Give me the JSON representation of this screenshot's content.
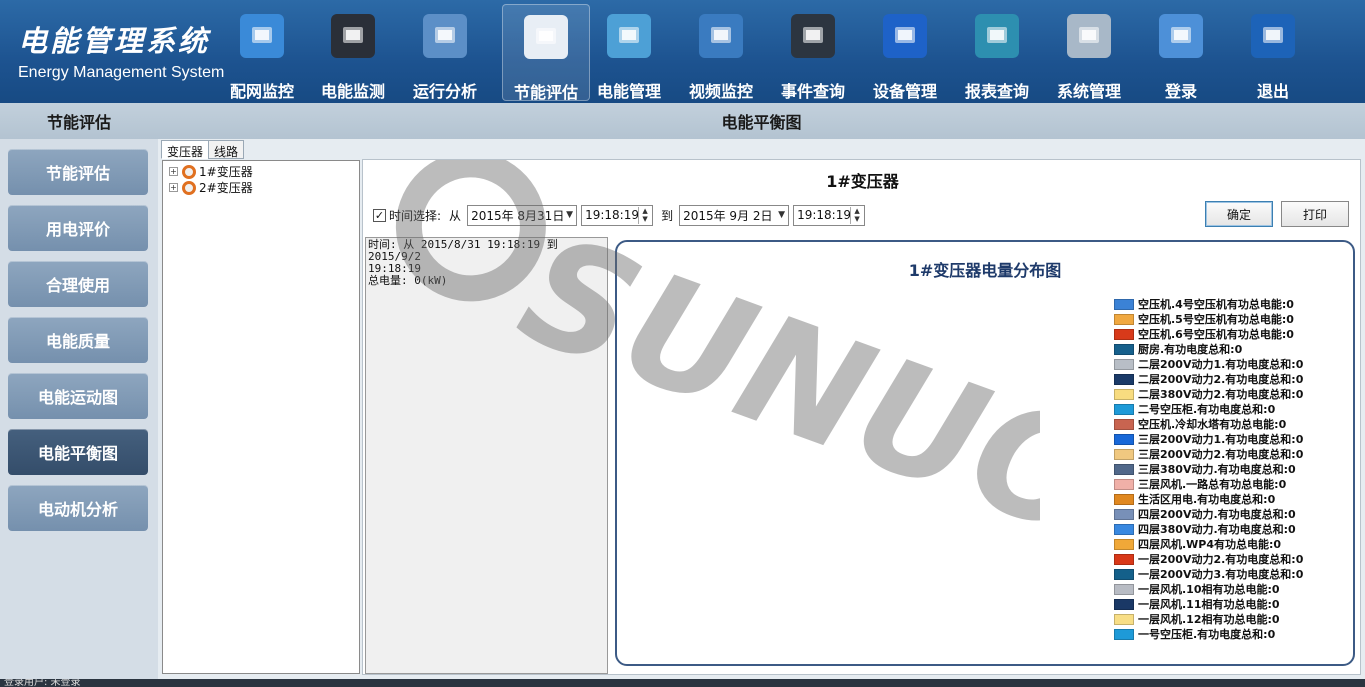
{
  "brand": {
    "cn": "电能管理系统",
    "en": "Energy Management System"
  },
  "nav": [
    {
      "label": "配网监控",
      "icon": "home-icon",
      "color": "#3a8ad8"
    },
    {
      "label": "电能监测",
      "icon": "monitor-icon",
      "color": "#2a2f38"
    },
    {
      "label": "运行分析",
      "icon": "line-chart-icon",
      "color": "#5c8fc7"
    },
    {
      "label": "节能评估",
      "icon": "document-pen-icon",
      "color": "#e8eef5"
    },
    {
      "label": "电能管理",
      "icon": "battery-icon",
      "color": "#4da0d6"
    },
    {
      "label": "视频监控",
      "icon": "webcam-icon",
      "color": "#3a7bc0"
    },
    {
      "label": "事件查询",
      "icon": "gear-tool-icon",
      "color": "#2c3540"
    },
    {
      "label": "设备管理",
      "icon": "train-icon",
      "color": "#1e62c8"
    },
    {
      "label": "报表查询",
      "icon": "laptop-icon",
      "color": "#2d8fb0"
    },
    {
      "label": "系统管理",
      "icon": "folder-tool-icon",
      "color": "#a8b8c8"
    },
    {
      "label": "登录",
      "icon": "finder-face-icon",
      "color": "#4d90d8"
    },
    {
      "label": "退出",
      "icon": "close-icon",
      "color": "#1d63b8"
    }
  ],
  "sidebar": {
    "title": "节能评估",
    "items": [
      {
        "label": "节能评估"
      },
      {
        "label": "用电评价"
      },
      {
        "label": "合理使用"
      },
      {
        "label": "电能质量"
      },
      {
        "label": "电能运动图"
      },
      {
        "label": "电能平衡图"
      },
      {
        "label": "电动机分析"
      }
    ]
  },
  "page_title": "电能平衡图",
  "tabs": [
    {
      "label": "变压器"
    },
    {
      "label": "线路"
    }
  ],
  "tree": [
    {
      "label": "1#变压器"
    },
    {
      "label": "2#变压器"
    }
  ],
  "content": {
    "title": "1#变压器",
    "time_label": "时间选择:",
    "from_label": "从",
    "to_label": "到",
    "from_date": "2015年 8月31日",
    "from_time": "19:18:19",
    "to_date": "2015年 9月 2日",
    "to_time": "19:18:19",
    "confirm_label": "确定",
    "print_label": "打印",
    "info_line1": "时间: 从 2015/8/31 19:18:19 到 2015/9/2",
    "info_line2": "19:18:19",
    "info_line3": "总电量: 0(kW)"
  },
  "chart_data": {
    "type": "pie",
    "title": "1#变压器电量分布图",
    "legend_placement": "right",
    "series": [
      {
        "name": "空压机.4号空压机有功总电能:0",
        "value": 0,
        "color": "#3b82d6"
      },
      {
        "name": "空压机.5号空压机有功总电能:0",
        "value": 0,
        "color": "#f0a840"
      },
      {
        "name": "空压机.6号空压机有功总电能:0",
        "value": 0,
        "color": "#d83a1a"
      },
      {
        "name": "厨房.有功电度总和:0",
        "value": 0,
        "color": "#16608c"
      },
      {
        "name": "二层200V动力1.有功电度总和:0",
        "value": 0,
        "color": "#b8bec6"
      },
      {
        "name": "二层200V动力2.有功电度总和:0",
        "value": 0,
        "color": "#1a3a68"
      },
      {
        "name": "二层380V动力2.有功电度总和:0",
        "value": 0,
        "color": "#f8dc80"
      },
      {
        "name": "二号空压柜.有功电度总和:0",
        "value": 0,
        "color": "#1e9ad8"
      },
      {
        "name": "空压机.冷却水塔有功总电能:0",
        "value": 0,
        "color": "#c86450"
      },
      {
        "name": "三层200V动力1.有功电度总和:0",
        "value": 0,
        "color": "#1868d8"
      },
      {
        "name": "三层200V动力2.有功电度总和:0",
        "value": 0,
        "color": "#f0c880"
      },
      {
        "name": "三层380V动力.有功电度总和:0",
        "value": 0,
        "color": "#50688a"
      },
      {
        "name": "三层风机.一路总有功总电能:0",
        "value": 0,
        "color": "#f0b0a8"
      },
      {
        "name": "生活区用电.有功电度总和:0",
        "value": 0,
        "color": "#e08820"
      },
      {
        "name": "四层200V动力.有功电度总和:0",
        "value": 0,
        "color": "#7890b8"
      },
      {
        "name": "四层380V动力.有功电度总和:0",
        "value": 0,
        "color": "#3888e0"
      },
      {
        "name": "四层风机.WP4有功总电能:0",
        "value": 0,
        "color": "#f0a838"
      },
      {
        "name": "一层200V动力2.有功电度总和:0",
        "value": 0,
        "color": "#d83818"
      },
      {
        "name": "一层200V动力3.有功电度总和:0",
        "value": 0,
        "color": "#14608a"
      },
      {
        "name": "一层风机.10相有功总电能:0",
        "value": 0,
        "color": "#b8bcc4"
      },
      {
        "name": "一层风机.11相有功总电能:0",
        "value": 0,
        "color": "#1a3866"
      },
      {
        "name": "一层风机.12相有功总电能:0",
        "value": 0,
        "color": "#f8de86"
      },
      {
        "name": "一号空压柜.有功电度总和:0",
        "value": 0,
        "color": "#1e9ad8"
      }
    ]
  },
  "watermark": "SUNUO",
  "status_text": "登录用户: 未登录"
}
